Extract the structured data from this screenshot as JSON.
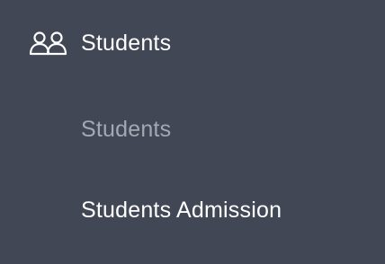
{
  "sidebar": {
    "parent": {
      "label": "Students",
      "icon": "users-icon"
    },
    "items": [
      {
        "label": "Students"
      },
      {
        "label": "Students Admission"
      }
    ]
  },
  "colors": {
    "background": "#414755",
    "text": "#ffffff",
    "muted_text": "#a3a8b2"
  }
}
